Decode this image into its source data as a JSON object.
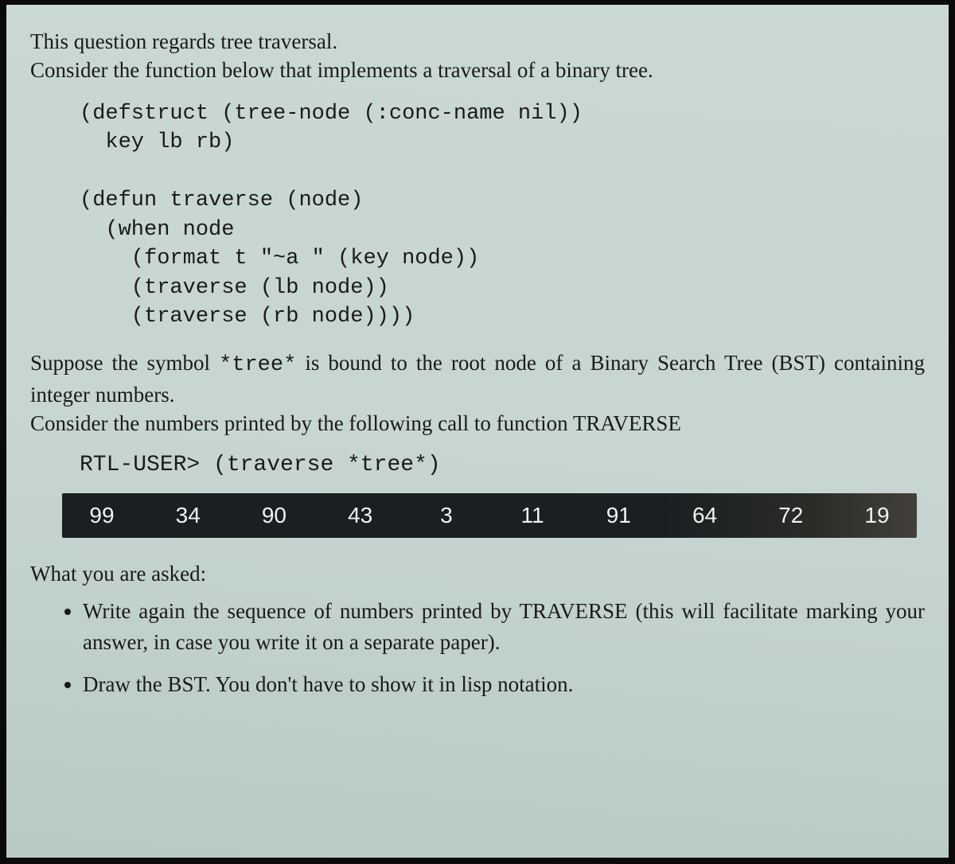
{
  "intro": {
    "line1": "This question regards tree traversal.",
    "line2": "Consider the function below that implements a traversal of a binary tree."
  },
  "code": "(defstruct (tree-node (:conc-name nil))\n  key lb rb)\n\n(defun traverse (node)\n  (when node\n    (format t \"~a \" (key node))\n    (traverse (lb node))\n    (traverse (rb node))))",
  "mid": {
    "line1_a": "Suppose the symbol ",
    "line1_b": "*tree*",
    "line1_c": " is bound to the root node of a Binary Search Tree (BST) containing integer numbers.",
    "line2": "Consider the numbers printed by the following call to function TRAVERSE"
  },
  "repl": "RTL-USER> (traverse *tree*)",
  "numbers": [
    "99",
    "34",
    "90",
    "43",
    "3",
    "11",
    "91",
    "64",
    "72",
    "19"
  ],
  "asked_heading": "What you are asked:",
  "tasks": [
    "Write again the sequence of numbers printed by TRAVERSE (this will facilitate marking your answer, in case you write it on a separate paper).",
    "Draw the BST. You don't have to show it in lisp notation."
  ]
}
